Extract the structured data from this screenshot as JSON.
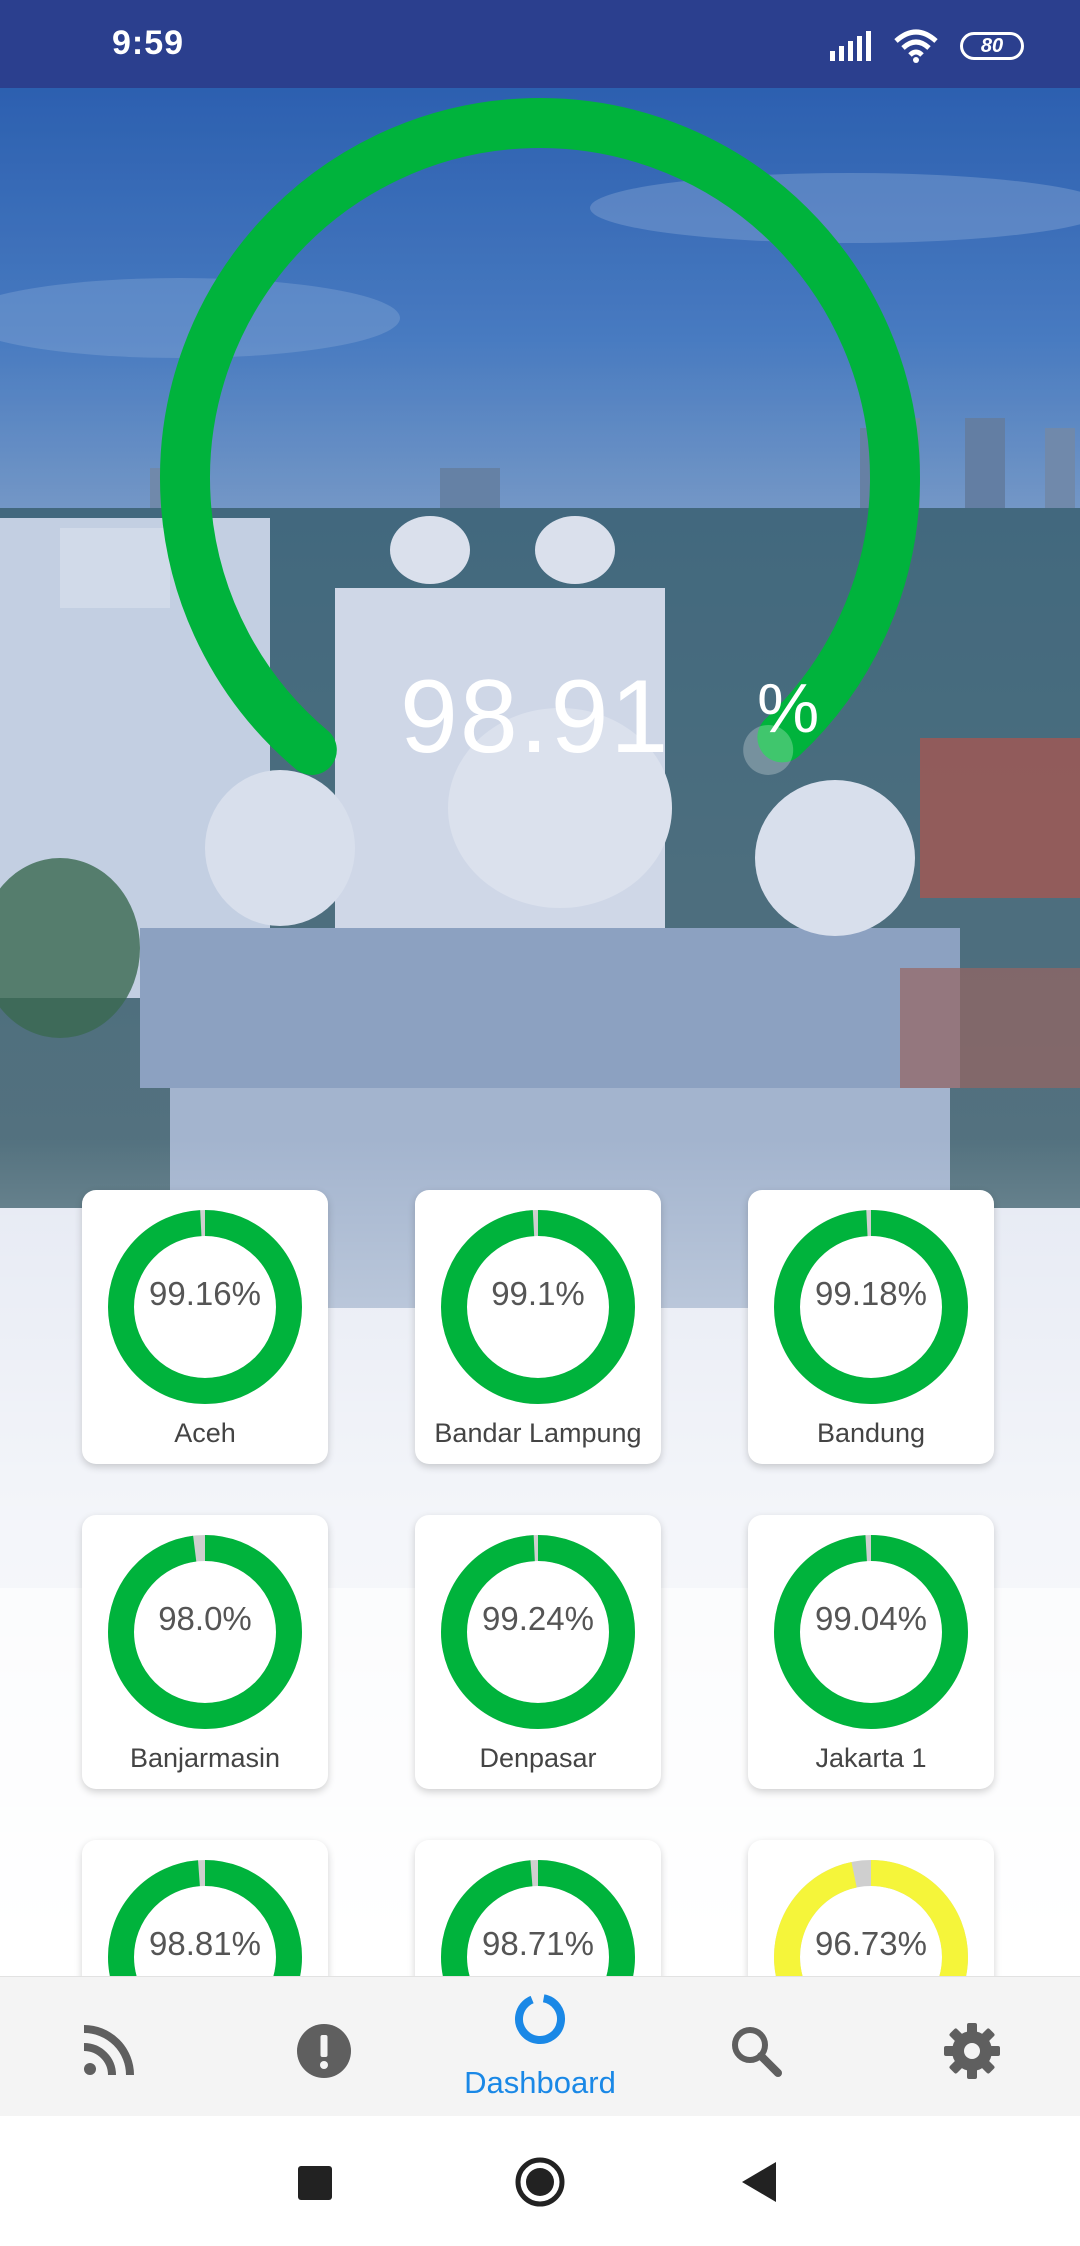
{
  "status_bar": {
    "time": "9:59",
    "battery": "80"
  },
  "overall": {
    "value": "98.91",
    "unit": "%",
    "fraction": 0.9891,
    "color": "#00b33c"
  },
  "regions": [
    {
      "name": "Aceh",
      "value": "99.16%",
      "fraction": 0.9916,
      "color": "#00b33c"
    },
    {
      "name": "Bandar Lampung",
      "value": "99.1%",
      "fraction": 0.991,
      "color": "#00b33c"
    },
    {
      "name": "Bandung",
      "value": "99.18%",
      "fraction": 0.9918,
      "color": "#00b33c"
    },
    {
      "name": "Banjarmasin",
      "value": "98.0%",
      "fraction": 0.98,
      "color": "#00b33c"
    },
    {
      "name": "Denpasar",
      "value": "99.24%",
      "fraction": 0.9924,
      "color": "#00b33c"
    },
    {
      "name": "Jakarta 1",
      "value": "99.04%",
      "fraction": 0.9904,
      "color": "#00b33c"
    },
    {
      "name": "",
      "value": "98.81%",
      "fraction": 0.9881,
      "color": "#00b33c"
    },
    {
      "name": "",
      "value": "98.71%",
      "fraction": 0.9871,
      "color": "#00b33c"
    },
    {
      "name": "",
      "value": "96.73%",
      "fraction": 0.9673,
      "color": "#f5f53a"
    }
  ],
  "bottom_nav": {
    "items": [
      {
        "id": "feed",
        "icon": "rss-icon",
        "label": ""
      },
      {
        "id": "alerts",
        "icon": "alert-icon",
        "label": ""
      },
      {
        "id": "dashboard",
        "icon": "dashboard-ring-icon",
        "label": "Dashboard",
        "active": true
      },
      {
        "id": "search",
        "icon": "search-icon",
        "label": ""
      },
      {
        "id": "settings",
        "icon": "gear-icon",
        "label": ""
      }
    ],
    "active_color": "#1a88e6",
    "inactive_color": "#5f5f5f"
  }
}
